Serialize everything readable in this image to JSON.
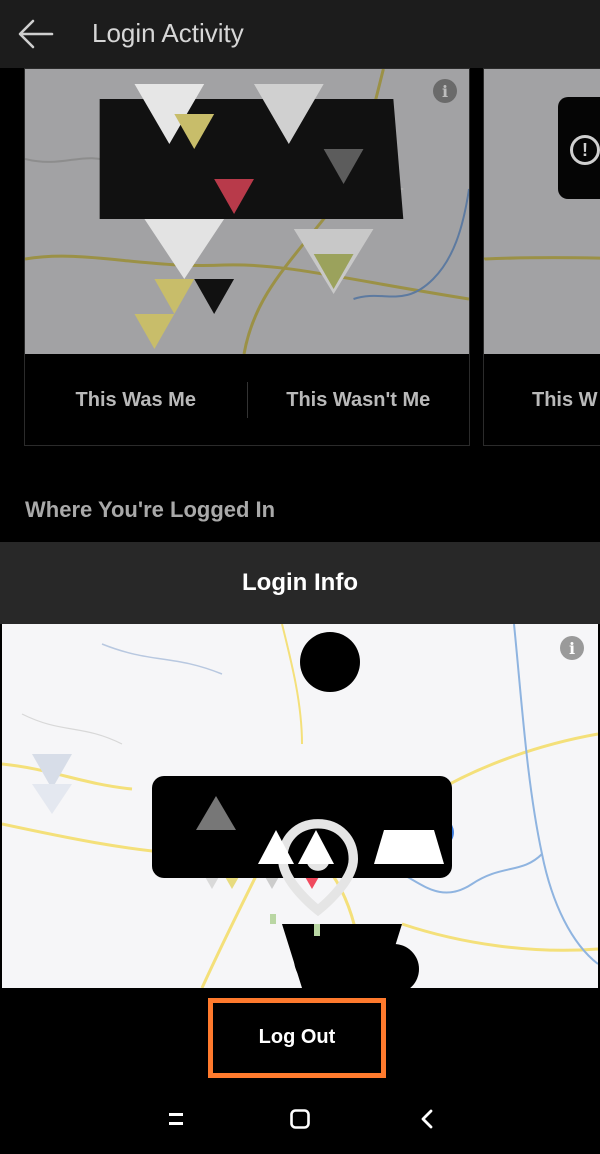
{
  "appbar": {
    "title": "Login Activity",
    "back_icon": "arrow-left-icon"
  },
  "recent_logins": {
    "cards": [
      {
        "confirm_label": "This Was Me",
        "deny_label": "This Wasn't Me",
        "info_icon": "info-icon"
      },
      {
        "confirm_label": "This W",
        "alert_icon": "alert-circle-icon"
      }
    ]
  },
  "logged_in": {
    "heading": "Where You're Logged In"
  },
  "sheet": {
    "title": "Login Info",
    "info_icon": "info-icon",
    "location_icon": "map-pin-icon",
    "logout_label": "Log Out",
    "highlight_color": "#ff7a2d"
  },
  "navbar": {
    "recents_icon": "recents-icon",
    "home_icon": "home-icon",
    "back_icon": "nav-back-icon"
  }
}
